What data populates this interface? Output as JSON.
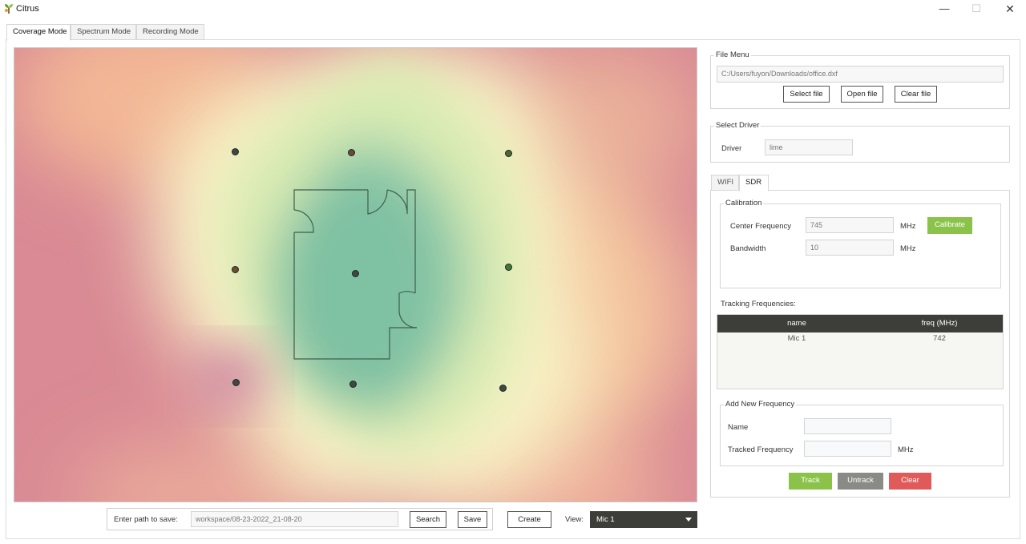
{
  "window": {
    "title": "Citrus",
    "minimize_glyph": "—",
    "maximize_glyph": "☐",
    "close_glyph": "✕"
  },
  "tabs": [
    {
      "label": "Coverage Mode",
      "active": true
    },
    {
      "label": "Spectrum Mode",
      "active": false
    },
    {
      "label": "Recording Mode",
      "active": false
    }
  ],
  "bottom": {
    "path_label": "Enter path to save:",
    "path_value": "workspace/08-23-2022_21-08-20",
    "search_label": "Search",
    "save_label": "Save",
    "create_label": "Create",
    "view_label": "View:",
    "view_selected": "Mic 1"
  },
  "file_menu": {
    "title": "File Menu",
    "path": "C:/Users/fuyon/Downloads/office.dxf",
    "select_label": "Select file",
    "open_label": "Open file",
    "clear_label": "Clear file"
  },
  "driver": {
    "title": "Select Driver",
    "label": "Driver",
    "value": "lime"
  },
  "sub_tabs": [
    {
      "label": "WIFI",
      "active": false
    },
    {
      "label": "SDR",
      "active": true
    }
  ],
  "calibration": {
    "title": "Calibration",
    "center_label": "Center Frequency",
    "center_value": "745",
    "center_unit": "MHz",
    "calibrate_label": "Calibrate",
    "bandwidth_label": "Bandwidth",
    "bandwidth_value": "10",
    "bandwidth_unit": "MHz"
  },
  "tracking": {
    "title": "Tracking Frequencies:",
    "columns": [
      "name",
      "freq (MHz)"
    ],
    "rows": [
      {
        "name": "Mic 1",
        "freq": "742"
      }
    ]
  },
  "add_frequency": {
    "title": "Add New Frequency",
    "name_label": "Name",
    "name_value": "",
    "tracked_label": "Tracked Frequency",
    "tracked_value": "",
    "unit": "MHz"
  },
  "actions": {
    "track_label": "Track",
    "untrack_label": "Untrack",
    "clear_label": "Clear"
  },
  "colors": {
    "accent_green": "#8bc34a",
    "dark_header": "#3d3d3a",
    "clear_red": "#e05a5a",
    "untrack_gray": "#8a8a86"
  }
}
